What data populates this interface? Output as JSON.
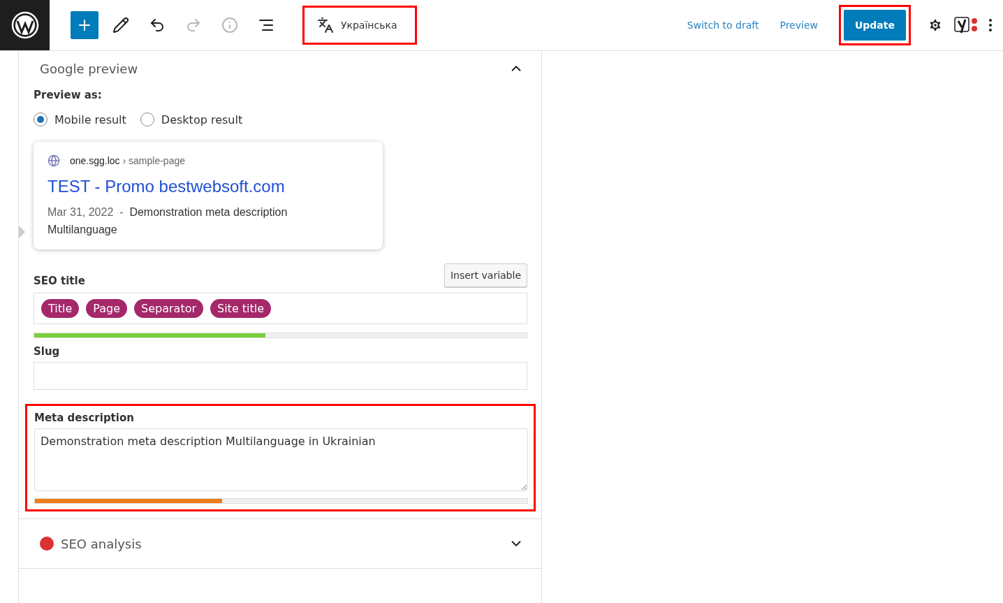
{
  "toolbar": {
    "tools": [
      {
        "kind": "add",
        "disabled": false
      },
      {
        "kind": "edit",
        "disabled": false
      },
      {
        "kind": "undo",
        "disabled": false
      },
      {
        "kind": "redo",
        "disabled": true
      },
      {
        "kind": "info",
        "disabled": true
      },
      {
        "kind": "outline",
        "disabled": false
      }
    ],
    "language": {
      "label": "Українська",
      "highlighted": true
    },
    "links": [
      "Switch to draft",
      "Preview"
    ],
    "update": {
      "label": "Update",
      "highlighted": true
    }
  },
  "google_preview": {
    "title": "Google preview",
    "expanded": true,
    "preview_as_label": "Preview as:",
    "modes": [
      {
        "label": "Mobile result",
        "selected": true
      },
      {
        "label": "Desktop result",
        "selected": false
      }
    ],
    "result": {
      "site": "one.sgg.loc",
      "path": "› sample-page",
      "title": "TEST - Promo bestwebsoft.com",
      "date": "Mar 31, 2022",
      "separator": "-",
      "description": "Demonstration meta description Multilanguage"
    }
  },
  "seo_title": {
    "label": "SEO title",
    "insert_button": "Insert variable",
    "tags": [
      "Title",
      "Page",
      "Separator",
      "Site title"
    ],
    "level": 0.47
  },
  "slug": {
    "label": "Slug"
  },
  "meta_description": {
    "label": "Meta description",
    "value": "Demonstration meta description Multilanguage in Ukrainian",
    "level": 0.38,
    "highlighted": true
  },
  "seo_analysis": {
    "title": "SEO analysis",
    "color": "#dc3232",
    "expanded": false
  }
}
